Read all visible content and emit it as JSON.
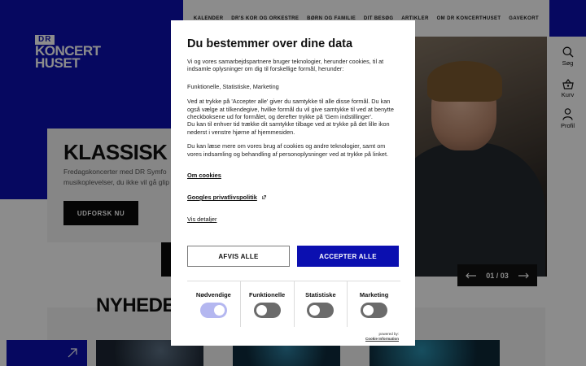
{
  "site": {
    "logo_line1": "DR",
    "logo_line2": "KONCERT",
    "logo_line3": "HUSET",
    "nav": [
      "KALENDER",
      "DR'S KOR OG ORKESTRE",
      "BØRN OG FAMILIE",
      "DIT BESØG",
      "ARTIKLER",
      "OM DR KONCERTHUSET",
      "GAVEKORT"
    ],
    "side": {
      "search_label": "Søg",
      "cart_label": "Kurv",
      "profile_label": "Profil"
    },
    "hero": {
      "title": "KLASSISK F",
      "text": "Fredagskoncerter med DR Symfo musikoplevelser, du ikke vil gå glip",
      "button": "UDFORSK NU",
      "counter": "01 / 03"
    },
    "news_title": "NYHEDER"
  },
  "consent": {
    "title": "Du bestemmer over dine data",
    "intro": "Vi og vores samarbejdspartnere bruger teknologier, herunder cookies, til at indsamle oplysninger om dig til forskellige formål, herunder:",
    "purposes": "Funktionelle, Statistiske, Marketing",
    "p1": "Ved at trykke på 'Accepter alle' giver du samtykke til alle disse formål. Du kan også vælge at tilkendegive, hvilke formål du vil give samtykke til ved at benytte checkboksene ud for formålet, og derefter trykke på 'Gem indstillinger'.",
    "p2": "Du kan til enhver tid trække dit samtykke tilbage ved at trykke på det lille ikon nederst i venstre hjørne af hjemmesiden.",
    "p3": "Du kan læse mere om vores brug af cookies og andre teknologier, samt om vores indsamling og behandling af personoplysninger ved at trykke på linket.",
    "link_cookies": "Om cookies",
    "link_google": "Googles privatlivspolitik",
    "link_details": "Vis detaljer",
    "reject_label": "AFVIS ALLE",
    "accept_label": "ACCEPTER ALLE",
    "toggles": [
      {
        "label": "Nødvendige",
        "state": "on"
      },
      {
        "label": "Funktionelle",
        "state": "off"
      },
      {
        "label": "Statistiske",
        "state": "off"
      },
      {
        "label": "Marketing",
        "state": "off"
      }
    ],
    "powered_by": "powered by:",
    "powered_name": "Cookie Information"
  },
  "colors": {
    "brand_blue": "#0b0fb0",
    "toggle_on": "#b4b7f0",
    "toggle_off": "#6b6b6b"
  }
}
